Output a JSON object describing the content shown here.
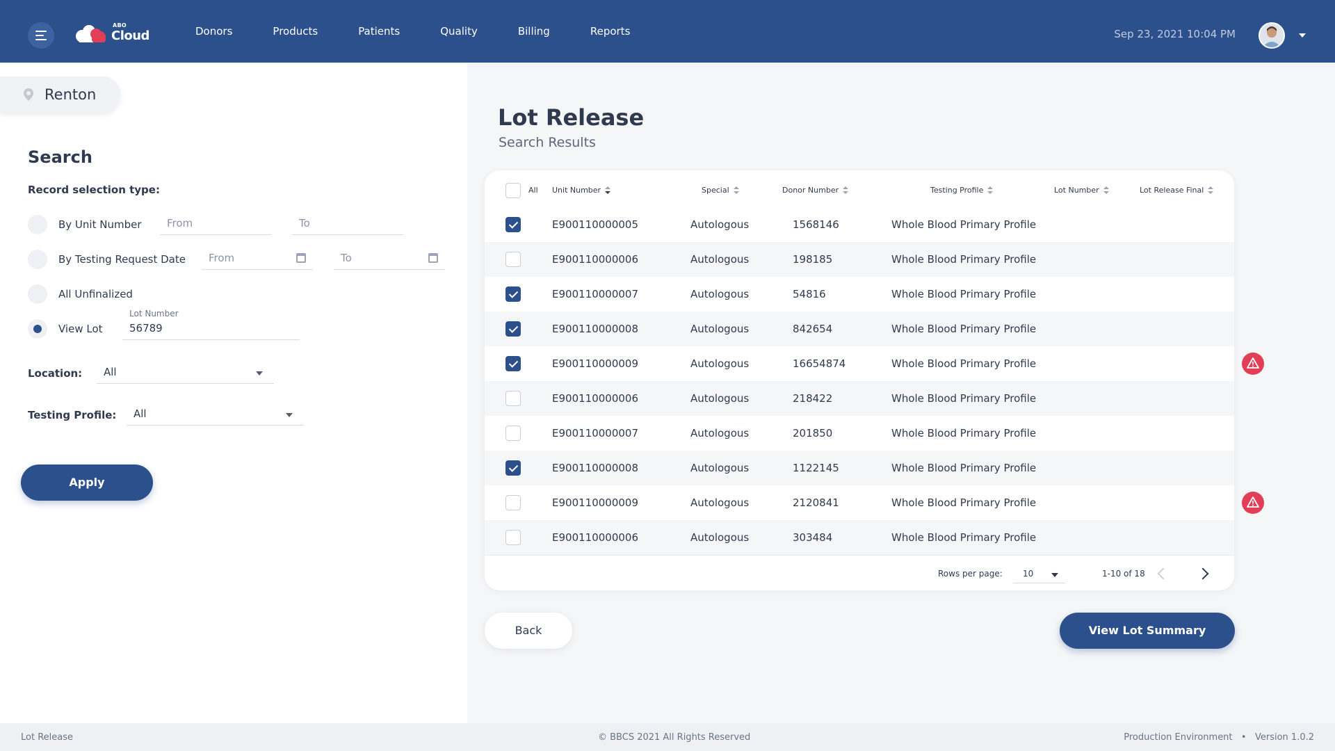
{
  "app": {
    "brand_small": "ABO",
    "brand_large": "Cloud"
  },
  "nav": {
    "items": [
      "Donors",
      "Products",
      "Patients",
      "Quality",
      "Billing",
      "Reports"
    ]
  },
  "header": {
    "datetime": "Sep 23, 2021 10:04 PM"
  },
  "location": {
    "name": "Renton"
  },
  "search": {
    "title": "Search",
    "record_selection_label": "Record selection type:",
    "options": {
      "by_unit": "By Unit Number",
      "by_date": "By Testing Request Date",
      "all_unfinalized": "All Unfinalized",
      "view_lot": "View Lot"
    },
    "selected_option": "view_lot",
    "unit_from_placeholder": "From",
    "unit_to_placeholder": "To",
    "date_from_placeholder": "From",
    "date_to_placeholder": "To",
    "lot_number_label": "Lot Number",
    "lot_number_value": "56789",
    "location_label": "Location:",
    "location_value": "All",
    "testing_profile_label": "Testing Profile:",
    "testing_profile_value": "All",
    "apply_label": "Apply"
  },
  "main": {
    "title": "Lot Release",
    "subtitle": "Search Results"
  },
  "table": {
    "headers": {
      "all": "All",
      "unit_number": "Unit Number",
      "special": "Special",
      "donor_number": "Donor Number",
      "testing_profile": "Testing Profile",
      "lot_number": "Lot Number",
      "lot_release_final": "Lot Release Final"
    },
    "rows": [
      {
        "unit": "E900110000005",
        "special": "Autologous",
        "donor": "1568146",
        "profile": "Whole Blood Primary Profile",
        "checked": true,
        "warning": false
      },
      {
        "unit": "E900110000006",
        "special": "Autologous",
        "donor": "198185",
        "profile": "Whole Blood Primary Profile",
        "checked": false,
        "warning": false
      },
      {
        "unit": "E900110000007",
        "special": "Autologous",
        "donor": "54816",
        "profile": "Whole Blood Primary Profile",
        "checked": true,
        "warning": false
      },
      {
        "unit": "E900110000008",
        "special": "Autologous",
        "donor": "842654",
        "profile": "Whole Blood Primary Profile",
        "checked": true,
        "warning": false
      },
      {
        "unit": "E900110000009",
        "special": "Autologous",
        "donor": "16654874",
        "profile": "Whole Blood Primary Profile",
        "checked": true,
        "warning": true
      },
      {
        "unit": "E900110000006",
        "special": "Autologous",
        "donor": "218422",
        "profile": "Whole Blood Primary Profile",
        "checked": false,
        "warning": false
      },
      {
        "unit": "E900110000007",
        "special": "Autologous",
        "donor": "201850",
        "profile": "Whole Blood Primary Profile",
        "checked": false,
        "warning": false
      },
      {
        "unit": "E900110000008",
        "special": "Autologous",
        "donor": "1122145",
        "profile": "Whole Blood Primary Profile",
        "checked": true,
        "warning": false
      },
      {
        "unit": "E900110000009",
        "special": "Autologous",
        "donor": "2120841",
        "profile": "Whole Blood Primary Profile",
        "checked": false,
        "warning": true
      },
      {
        "unit": "E900110000006",
        "special": "Autologous",
        "donor": "303484",
        "profile": "Whole Blood Primary Profile",
        "checked": false,
        "warning": false
      }
    ],
    "pagination": {
      "rows_per_page_label": "Rows per page:",
      "rows_per_page": "10",
      "range": "1-10 of 18"
    }
  },
  "actions": {
    "back_label": "Back",
    "view_lot_summary_label": "View Lot Summary"
  },
  "footer": {
    "left": "Lot Release",
    "center": "© BBCS 2021 All Rights Reserved",
    "right": "Production Environment   •   Version 1.0.2"
  },
  "colors": {
    "primary": "#2b508b",
    "warning": "#e23e57",
    "background": "#f5f6f8"
  }
}
